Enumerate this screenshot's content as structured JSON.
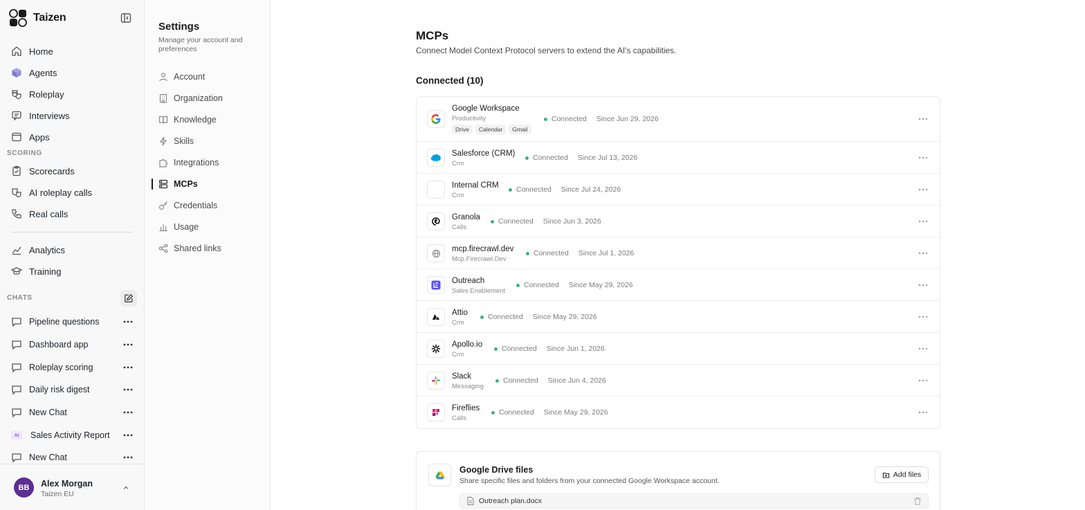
{
  "brand": {
    "name": "Taizen"
  },
  "nav": {
    "items": [
      {
        "label": "Home",
        "icon": "home-icon"
      },
      {
        "label": "Agents",
        "icon": "cube-icon"
      },
      {
        "label": "Roleplay",
        "icon": "masks-icon"
      },
      {
        "label": "Interviews",
        "icon": "chat-icon"
      },
      {
        "label": "Apps",
        "icon": "app-icon"
      }
    ],
    "scoring_label": "SCORING",
    "scoring_items": [
      {
        "label": "Scorecards",
        "icon": "clipboard-icon"
      },
      {
        "label": "AI roleplay calls",
        "icon": "masks-icon"
      },
      {
        "label": "Real calls",
        "icon": "phone-icon"
      }
    ],
    "other_items": [
      {
        "label": "Analytics",
        "icon": "chart-icon"
      },
      {
        "label": "Training",
        "icon": "graduation-cap-icon"
      }
    ],
    "chats_label": "CHATS",
    "chats": [
      {
        "label": "Pipeline questions",
        "badge": ""
      },
      {
        "label": "Dashboard app",
        "badge": ""
      },
      {
        "label": "Roleplay scoring",
        "badge": ""
      },
      {
        "label": "Daily risk digest",
        "badge": ""
      },
      {
        "label": "New Chat",
        "badge": ""
      },
      {
        "label": "Sales Activity Report",
        "badge": "AI"
      },
      {
        "label": "New Chat",
        "badge": ""
      }
    ]
  },
  "user": {
    "initials": "BB",
    "name": "Alex Morgan",
    "org": "Taizen EU"
  },
  "settings": {
    "title": "Settings",
    "subtitle": "Manage your account and preferences",
    "items": [
      {
        "label": "Account",
        "icon": "user-icon",
        "active": false
      },
      {
        "label": "Organization",
        "icon": "building-icon",
        "active": false
      },
      {
        "label": "Knowledge",
        "icon": "book-icon",
        "active": false
      },
      {
        "label": "Skills",
        "icon": "bolt-icon",
        "active": false
      },
      {
        "label": "Integrations",
        "icon": "puzzle-icon",
        "active": false
      },
      {
        "label": "MCPs",
        "icon": "server-icon",
        "active": true
      },
      {
        "label": "Credentials",
        "icon": "key-icon",
        "active": false
      },
      {
        "label": "Usage",
        "icon": "bar-chart-icon",
        "active": false
      },
      {
        "label": "Shared links",
        "icon": "share-icon",
        "active": false
      }
    ]
  },
  "main": {
    "title": "MCPs",
    "description": "Connect Model Context Protocol servers to extend the AI's capabilities.",
    "connected_title": "Connected (10)",
    "servers": [
      {
        "name": "Google Workspace",
        "category": "Productivity",
        "status": "Connected",
        "since": "Since Jun 29, 2026",
        "tags": [
          "Drive",
          "Calendar",
          "Gmail"
        ],
        "icon": "google-icon"
      },
      {
        "name": "Salesforce (CRM)",
        "category": "Crm",
        "status": "Connected",
        "since": "Since Jul 13, 2026",
        "tags": [],
        "icon": "salesforce-icon"
      },
      {
        "name": "Internal CRM",
        "category": "Crm",
        "status": "Connected",
        "since": "Since Jul 24, 2026",
        "tags": [],
        "icon": "blank-icon"
      },
      {
        "name": "Granola",
        "category": "Calls",
        "status": "Connected",
        "since": "Since Jun 3, 2026",
        "tags": [],
        "icon": "granola-icon"
      },
      {
        "name": "mcp.firecrawl.dev",
        "category": "Mcp.Firecrawl.Dev",
        "status": "Connected",
        "since": "Since Jul 1, 2026",
        "tags": [],
        "icon": "globe-icon"
      },
      {
        "name": "Outreach",
        "category": "Sales Enablement",
        "status": "Connected",
        "since": "Since May 29, 2026",
        "tags": [],
        "icon": "outreach-icon"
      },
      {
        "name": "Attio",
        "category": "Crm",
        "status": "Connected",
        "since": "Since May 29, 2026",
        "tags": [],
        "icon": "attio-icon"
      },
      {
        "name": "Apollo.io",
        "category": "Crm",
        "status": "Connected",
        "since": "Since Jun 1, 2026",
        "tags": [],
        "icon": "apollo-icon"
      },
      {
        "name": "Slack",
        "category": "Messaging",
        "status": "Connected",
        "since": "Since Jun 4, 2026",
        "tags": [],
        "icon": "slack-icon"
      },
      {
        "name": "Fireflies",
        "category": "Calls",
        "status": "Connected",
        "since": "Since May 29, 2026",
        "tags": [],
        "icon": "fireflies-icon"
      }
    ],
    "drive": {
      "title": "Google Drive files",
      "description": "Share specific files and folders from your connected Google Workspace account.",
      "add_label": "Add files",
      "files": [
        "Outreach plan.docx"
      ]
    }
  },
  "colors": {
    "connected": "#3fb27f",
    "avatar": "#5b2f91",
    "outreach": "#5951ff",
    "salesforce": "#00a1e0"
  }
}
